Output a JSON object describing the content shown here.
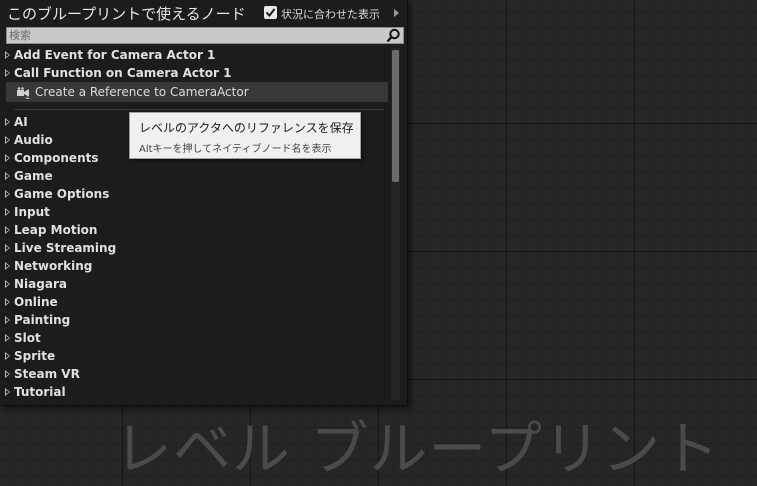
{
  "panel": {
    "title": "このブループリントで使えるノード",
    "context_checkbox_checked": true,
    "context_label": "状況に合わせた表示",
    "search": {
      "placeholder": "検索",
      "value": ""
    },
    "top_items": [
      "Add Event for Camera Actor 1",
      "Call Function on Camera Actor 1"
    ],
    "reference_item": {
      "label": "Create a Reference to CameraActor",
      "icon": "camera-reference-icon"
    },
    "categories": [
      "AI",
      "Audio",
      "Components",
      "Game",
      "Game Options",
      "Input",
      "Leap Motion",
      "Live Streaming",
      "Networking",
      "Niagara",
      "Online",
      "Painting",
      "Slot",
      "Sprite",
      "Steam VR",
      "Tutorial"
    ]
  },
  "tooltip": {
    "title": "レベルのアクタへのリファレンスを保存",
    "hint": "Altキーを押してネイティブノード名を表示"
  },
  "canvas": {
    "watermark": "レベル ブループリント"
  },
  "colors": {
    "panel_bg": "#1c1c1c",
    "grid_bg": "#262626",
    "selected_row": "#383838",
    "tooltip_bg": "#f0f0f0"
  }
}
